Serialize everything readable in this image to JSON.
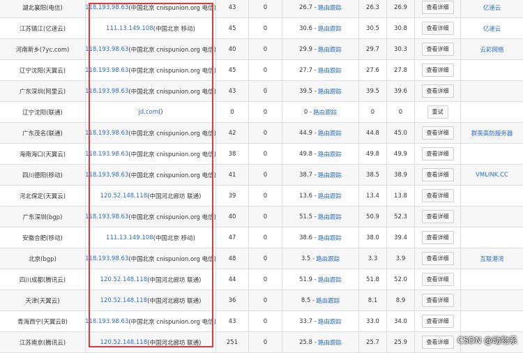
{
  "rows": [
    {
      "location": "湖北襄阳(电信)",
      "ip": "118.193.98.63",
      "ip_info": "(中国北京 cnispunion.org 电信)",
      "col3": "43",
      "col4": "0",
      "avg": "26.7",
      "route": "路由跟踪",
      "v1": "26.3",
      "v2": "26.9",
      "button": "查看详细",
      "sponsor": "亿速云"
    },
    {
      "location": "江苏镇江(亿速云)",
      "ip": "111.13.149.108",
      "ip_info": "(中国北京 移动)",
      "col3": "45",
      "col4": "0",
      "avg": "30.6",
      "route": "路由跟踪",
      "v1": "30.5",
      "v2": "30.8",
      "button": "查看详细",
      "sponsor": "亿速云"
    },
    {
      "location": "河南新乡(7yc.com)",
      "ip": "118.193.98.63",
      "ip_info": "(中国北京 cnispunion.org 电信)",
      "col3": "40",
      "col4": "0",
      "avg": "29.9",
      "route": "路由跟踪",
      "v1": "29.7",
      "v2": "30.3",
      "button": "查看详细",
      "sponsor": "云彩网络"
    },
    {
      "location": "辽宁沈阳(天翼云)",
      "ip": "118.193.98.63",
      "ip_info": "(中国北京 cnispunion.org 电信)",
      "col3": "45",
      "col4": "0",
      "avg": "27.7",
      "route": "路由跟踪",
      "v1": "27.6",
      "v2": "27.8",
      "button": "查看详细",
      "sponsor": ""
    },
    {
      "location": "广东深圳(阿里云)",
      "ip": "118.193.98.63",
      "ip_info": "(中国北京 cnispunion.org 电信)",
      "col3": "43",
      "col4": "0",
      "avg": "39.5",
      "route": "路由跟踪",
      "v1": "39.5",
      "v2": "39.6",
      "button": "查看详细",
      "sponsor": ""
    },
    {
      "location": "辽宁沈阳(联通)",
      "ip": "jd.com",
      "ip_info": "()",
      "col3": "0",
      "col4": "0",
      "avg": "0",
      "route": "路由跟踪",
      "v1": "0",
      "v2": "0",
      "button": "重试",
      "sponsor": ""
    },
    {
      "location": "广东茂名(联通)",
      "ip": "118.193.98.63",
      "ip_info": "(中国北京 cnispunion.org 电信)",
      "col3": "42",
      "col4": "0",
      "avg": "44.9",
      "route": "路由跟踪",
      "v1": "44.8",
      "v2": "45.0",
      "button": "查看详细",
      "sponsor": "群英高防服务器"
    },
    {
      "location": "海南海口(天翼云)",
      "ip": "118.193.98.63",
      "ip_info": "(中国北京 cnispunion.org 电信)",
      "col3": "38",
      "col4": "0",
      "avg": "49.8",
      "route": "路由跟踪",
      "v1": "49.8",
      "v2": "49.9",
      "button": "查看详细",
      "sponsor": ""
    },
    {
      "location": "四川德阳(移动)",
      "ip": "118.193.98.63",
      "ip_info": "(中国北京 cnispunion.org 电信)",
      "col3": "41",
      "col4": "0",
      "avg": "38.7",
      "route": "路由跟踪",
      "v1": "38.5",
      "v2": "38.9",
      "button": "查看详细",
      "sponsor": "VMLINK.CC"
    },
    {
      "location": "河北保定(天翼云)",
      "ip": "120.52.148.118",
      "ip_info": "(中国河北廊坊 联通)",
      "col3": "39",
      "col4": "0",
      "avg": "13.6",
      "route": "路由跟踪",
      "v1": "13.4",
      "v2": "13.8",
      "button": "查看详细",
      "sponsor": ""
    },
    {
      "location": "广东深圳(bgp)",
      "ip": "118.193.98.63",
      "ip_info": "(中国北京 cnispunion.org 电信)",
      "col3": "40",
      "col4": "0",
      "avg": "51.5",
      "route": "路由跟踪",
      "v1": "50.9",
      "v2": "52.3",
      "button": "查看详细",
      "sponsor": ""
    },
    {
      "location": "安徽合肥(移动)",
      "ip": "111.13.149.108",
      "ip_info": "(中国北京 移动)",
      "col3": "47",
      "col4": "0",
      "avg": "38.6",
      "route": "路由跟踪",
      "v1": "38.0",
      "v2": "39.4",
      "button": "查看详细",
      "sponsor": ""
    },
    {
      "location": "北京(bgp)",
      "ip": "118.193.98.63",
      "ip_info": "(中国北京 cnispunion.org 电信)",
      "col3": "48",
      "col4": "0",
      "avg": "3.5",
      "route": "路由跟踪",
      "v1": "3.3",
      "v2": "3.9",
      "button": "查看详细",
      "sponsor": "互联港湾"
    },
    {
      "location": "四川成都(腾讯云)",
      "ip": "120.52.148.118",
      "ip_info": "(中国河北廊坊 联通)",
      "col3": "44",
      "col4": "0",
      "avg": "51.9",
      "route": "路由跟踪",
      "v1": "51.8",
      "v2": "52.0",
      "button": "查看详细",
      "sponsor": ""
    },
    {
      "location": "天津(天翼云)",
      "ip": "120.52.148.118",
      "ip_info": "(中国河北廊坊 联通)",
      "col3": "36",
      "col4": "0",
      "avg": "8.5",
      "route": "路由跟踪",
      "v1": "8.1",
      "v2": "8.9",
      "button": "查看详细",
      "sponsor": ""
    },
    {
      "location": "青海西宁(天翼云B)",
      "ip": "118.193.98.63",
      "ip_info": "(中国北京 cnispunion.org 电信)",
      "col3": "43",
      "col4": "0",
      "avg": "33.7",
      "route": "路由跟踪",
      "v1": "33.0",
      "v2": "34.0",
      "button": "查看详细",
      "sponsor": ""
    },
    {
      "location": "江苏南京(腾讯云)",
      "ip": "120.52.148.118",
      "ip_info": "(中国河北廊坊 联通)",
      "col3": "251",
      "col4": "0",
      "avg": "25.8",
      "route": "路由跟踪",
      "v1": "25.7",
      "v2": "25.9",
      "button": "查看详细",
      "sponsor": ""
    }
  ],
  "watermark": "CSDN @动物系",
  "colors": {
    "link": "#2a6cc7",
    "highlight_border": "#e0393a",
    "row_alt": "#f7f7f7",
    "grid": "#dddddd"
  }
}
